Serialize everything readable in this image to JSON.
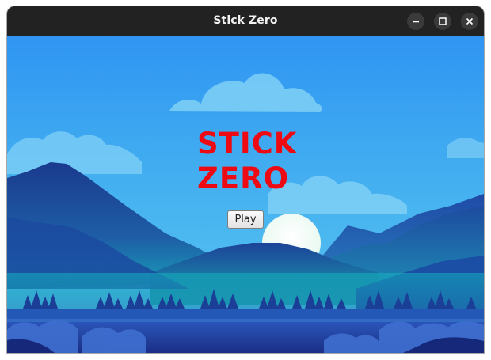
{
  "window": {
    "title": "Stick Zero"
  },
  "window_controls": {
    "minimize_icon": "minimize-icon",
    "maximize_icon": "maximize-icon",
    "close_icon": "close-icon"
  },
  "menu": {
    "title_line1": "STICK",
    "title_line2": "ZERO",
    "title_color": "#ee0a12",
    "play_label": "Play"
  },
  "background": {
    "scene": "mountain landscape with clouds, sun and pine trees",
    "sky_color": "#3aa3f0",
    "mountain_color": "#1c3f94",
    "sun_color": "#f2fbf7"
  }
}
